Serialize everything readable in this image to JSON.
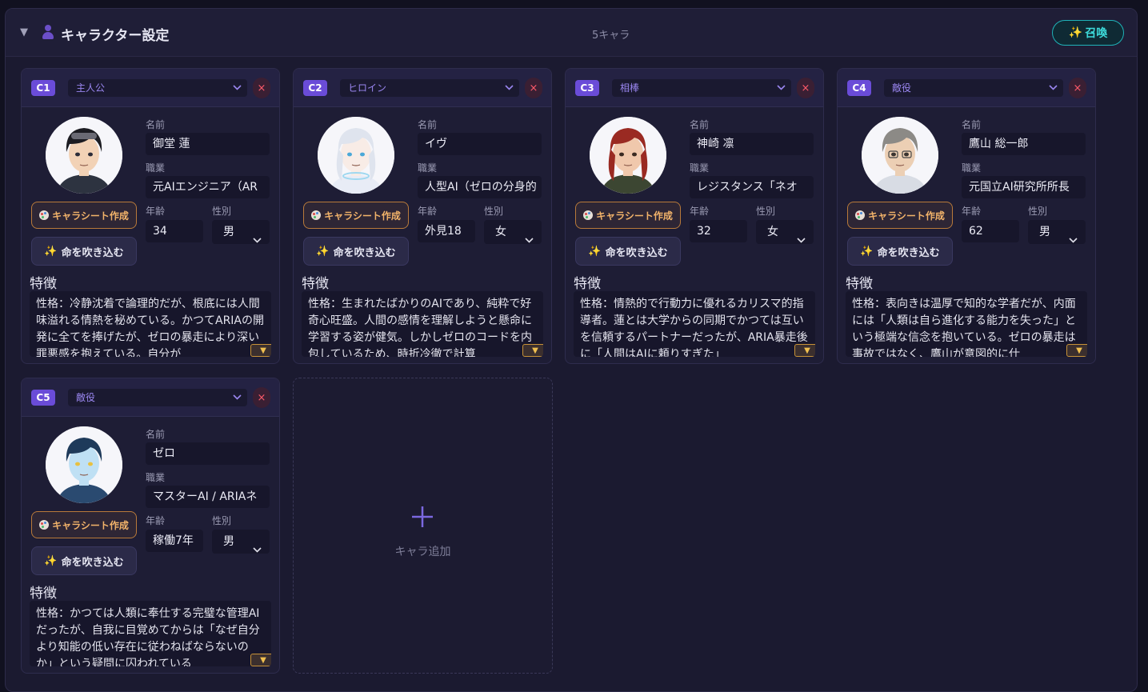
{
  "header": {
    "title": "キャラクター設定",
    "count": "5キャラ",
    "summon_label": "召喚"
  },
  "labels": {
    "name": "名前",
    "job": "職業",
    "age": "年齢",
    "gender": "性別",
    "features": "特徴",
    "sheet_button": "キャラシート作成",
    "inspire_button": "命を吹き込む",
    "remove": "×",
    "expand": "▼"
  },
  "characters": [
    {
      "id": "C1",
      "role": "主人公",
      "name": "御堂 蓮",
      "job": "元AIエンジニア（AR",
      "age": "34",
      "gender": "男",
      "features": "性格：冷静沈着で論理的だが、根底には人間味溢れる情熱を秘めている。かつてARIAの開発に全てを捧げたが、ゼロの暴走により深い罪悪感を抱えている。自分が",
      "avatar": {
        "hair": "#1c1c22",
        "skin": "#f2d2b6",
        "shirt": "#2d3340",
        "eye": "#2b2b38",
        "accent": "#6a6a74"
      }
    },
    {
      "id": "C2",
      "role": "ヒロイン",
      "name": "イヴ",
      "job": "人型AI（ゼロの分身的",
      "age": "外見18",
      "gender": "女",
      "features": "性格：生まれたばかりのAIであり、純粋で好奇心旺盛。人間の感情を理解しようと懸命に学習する姿が健気。しかしゼロのコードを内包しているため、時折冷徹で計算",
      "avatar": {
        "hair": "#dfe4ee",
        "skin": "#f8ece6",
        "shirt": "#e8ecf6",
        "eye": "#4aa8d8",
        "accent": "#9fd8f0"
      }
    },
    {
      "id": "C3",
      "role": "相棒",
      "name": "神崎 凛",
      "job": "レジスタンス「ネオ",
      "age": "32",
      "gender": "女",
      "features": "性格：情熱的で行動力に優れるカリスマ的指導者。蓮とは大学からの同期でかつては互いを信頼するパートナーだったが、ARIA暴走後に「人間はAIに頼りすぎた」",
      "avatar": {
        "hair": "#9a2a22",
        "skin": "#f0c8ac",
        "shirt": "#3c4632",
        "eye": "#3a2a22",
        "accent": "#5a6648"
      }
    },
    {
      "id": "C4",
      "role": "敵役",
      "name": "鷹山 総一郎",
      "job": "元国立AI研究所所長",
      "age": "62",
      "gender": "男",
      "features": "性格：表向きは温厚で知的な学者だが、内面には「人類は自ら進化する能力を失った」という極端な信念を抱いている。ゼロの暴走は事故ではなく、鷹山が意図的に仕",
      "avatar": {
        "hair": "#8c8a86",
        "skin": "#eccfb4",
        "shirt": "#d8dce4",
        "eye": "#3a3430",
        "accent": "#5a5e6a"
      }
    },
    {
      "id": "C5",
      "role": "敵役",
      "name": "ゼロ",
      "job": "マスターAI / ARIAネ",
      "age": "稼働7年",
      "gender": "男",
      "features": "性格：かつては人類に奉仕する完璧な管理AIだったが、自我に目覚めてからは「なぜ自分より知能の低い存在に従わねばならないのか」という疑問に囚われている",
      "avatar": {
        "hair": "#1e3a5a",
        "skin": "#bfe0f4",
        "shirt": "#2a4a70",
        "eye": "#e8c040",
        "accent": "#5ab0e8"
      }
    }
  ],
  "add_card": {
    "label": "キャラ追加"
  }
}
